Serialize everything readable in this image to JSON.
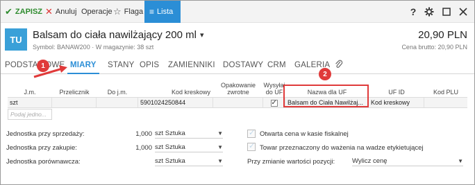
{
  "toolbar": {
    "save_label": "ZAPISZ",
    "cancel_label": "Anuluj",
    "operations_label": "Operacje",
    "flag_label": "Flaga",
    "list_label": "Lista",
    "help_label": "?"
  },
  "product": {
    "avatar": "TU",
    "name": "Balsam do ciała nawilżający 200 ml",
    "subline": "Symbol: BANAW200  ·  W magazynie: 38 szt",
    "price": "20,90 PLN",
    "price_sub": "Cena brutto: 20,90 PLN"
  },
  "tabs": [
    "PODSTAWOWE",
    "MIARY",
    "STANY",
    "OPIS",
    "ZAMIENNIKI",
    "DOSTAWY",
    "CRM",
    "GALERIA"
  ],
  "grid": {
    "columns": [
      "J.m.",
      "Przelicznik",
      "Do j.m.",
      "Kod kreskowy",
      "Opakowanie zwrotne",
      "Wysyłaj do UF",
      "Nazwa dla UF",
      "UF ID",
      "Kod PLU"
    ],
    "row": {
      "unit": "szt",
      "converter": "",
      "to_unit": "",
      "barcode": "5901024250844",
      "returnable": "",
      "send_to_uf": true,
      "uf_name": "Balsam do Ciała Nawilżaj...",
      "uf_id": "Kod kreskowy",
      "plu": ""
    },
    "add_placeholder": "Podaj jedno..."
  },
  "form": {
    "sales_unit_label": "Jednostka przy sprzedaży:",
    "sales_unit_qty": "1,000",
    "sales_unit_value": "szt  Sztuka",
    "purchase_unit_label": "Jednostka przy zakupie:",
    "purchase_unit_qty": "1,000",
    "purchase_unit_value": "szt  Sztuka",
    "compare_unit_label": "Jednostka porównawcza:",
    "compare_unit_value": "szt  Sztuka",
    "open_price_label": "Otwarta cena w kasie fiskalnej",
    "weighed_label": "Towar przeznaczony do ważenia na wadze etykietującej",
    "position_change_label": "Przy zmianie wartości pozycji:",
    "position_change_value": "Wylicz cenę"
  },
  "markers": [
    "1",
    "2"
  ],
  "colors": {
    "accent": "#2b8ed6",
    "save": "#2e8b2e",
    "marker": "#e03a3a"
  }
}
